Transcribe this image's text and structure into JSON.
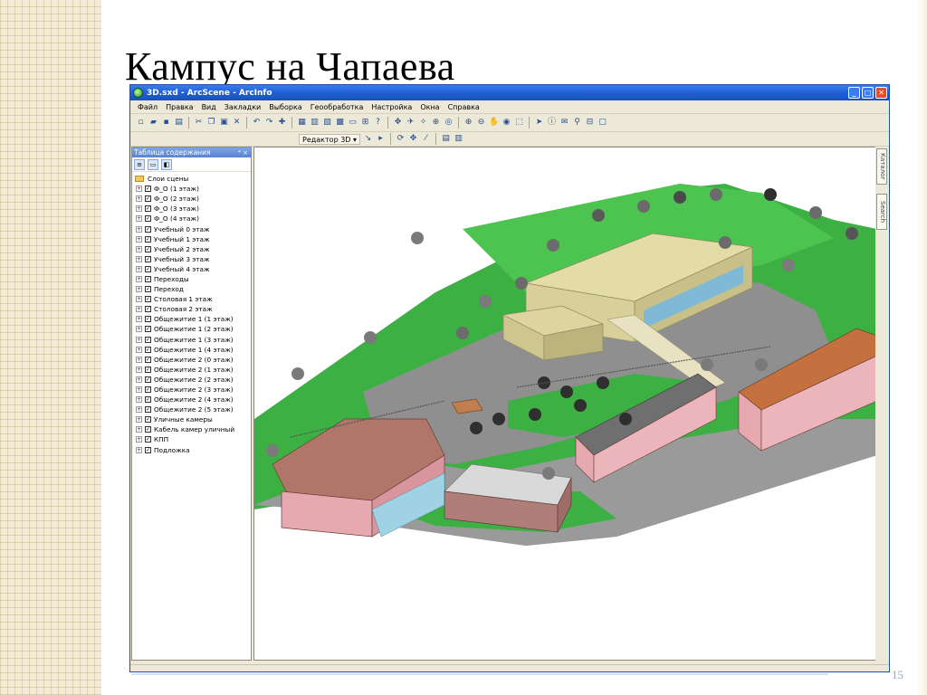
{
  "slide": {
    "title": "Кампус на Чапаева",
    "number": "15"
  },
  "window": {
    "title": "3D.sxd - ArcScene - ArcInfo",
    "controls": [
      "_",
      "□",
      "✕"
    ]
  },
  "menu": [
    "Файл",
    "Правка",
    "Вид",
    "Закладки",
    "Выборка",
    "Геообработка",
    "Настройка",
    "Окна",
    "Справка"
  ],
  "toolbar": {
    "editor_label": "Редактор 3D ▾"
  },
  "toc": {
    "header": "Таблица содержания",
    "pin": "⁴ ×",
    "root": "Слои сцены",
    "layers": [
      "Ф_О (1 этаж)",
      "Ф_О (2 этаж)",
      "Ф_О (3 этаж)",
      "Ф_О (4 этаж)",
      "Учебный 0 этаж",
      "Учебный 1 этаж",
      "Учебный 2 этаж",
      "Учебный 3 этаж",
      "Учебный 4 этаж",
      "Переходы",
      "Переход",
      "Столовая 1 этаж",
      "Столовая 2 этаж",
      "Общежитие 1 (1 этаж)",
      "Общежитие 1 (2 этаж)",
      "Общежитие 1 (3 этаж)",
      "Общежитие 1 (4 этаж)",
      "Общежитие 2 (0 этаж)",
      "Общежитие 2 (1 этаж)",
      "Общежитие 2 (2 этаж)",
      "Общежитие 2 (3 этаж)",
      "Общежитие 2 (4 этаж)",
      "Общежитие 2 (5 этаж)",
      "Уличные камеры",
      "Кабель камер уличный",
      "КПП",
      "Подложка"
    ]
  },
  "side_tabs": [
    "Каталог",
    "Search"
  ],
  "colors": {
    "grass": "#3cb043",
    "road": "#8a8a8a",
    "roof_brown": "#b0766a",
    "roof_tan": "#d8cf9a",
    "wall_pink": "#e6a9b0",
    "titlebar": "#1f5fd6"
  }
}
